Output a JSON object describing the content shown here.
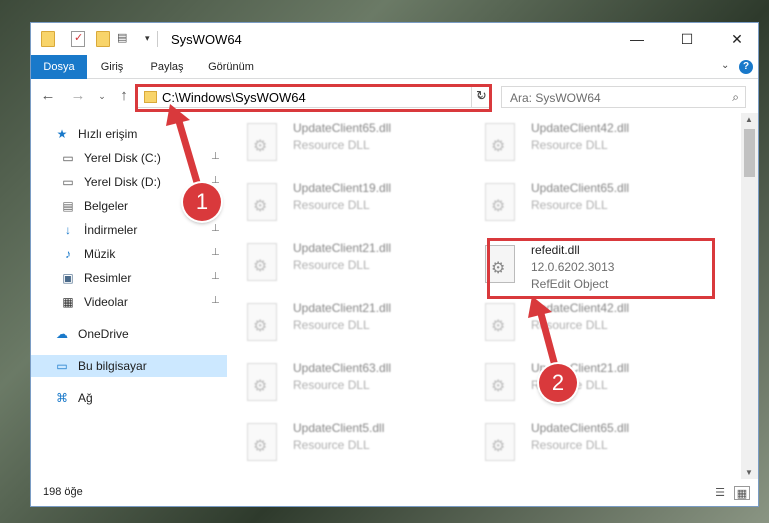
{
  "window": {
    "title": "SysWOW64",
    "minimize": "—",
    "maximize": "☐",
    "close": "✕"
  },
  "ribbon": {
    "tabs": [
      "Dosya",
      "Giriş",
      "Paylaş",
      "Görünüm"
    ],
    "help": "?",
    "expand": "⌄"
  },
  "nav": {
    "back": "←",
    "forward": "→",
    "recent": "⌄",
    "up": "↑",
    "address": "C:\\Windows\\SysWOW64",
    "address_chevron": "⌄",
    "refresh": "↻",
    "search_placeholder": "Ara: SysWOW64",
    "search_icon": "⌕"
  },
  "sidebar": {
    "items": [
      {
        "label": "Hızlı erişim",
        "icon": "★",
        "pinned": false,
        "top": true
      },
      {
        "label": "Yerel Disk (C:)",
        "icon": "▭",
        "pinned": true
      },
      {
        "label": "Yerel Disk (D:)",
        "icon": "▭",
        "pinned": true
      },
      {
        "label": "Belgeler",
        "icon": "▤",
        "pinned": true
      },
      {
        "label": "İndirmeler",
        "icon": "↓",
        "pinned": true
      },
      {
        "label": "Müzik",
        "icon": "♪",
        "pinned": true
      },
      {
        "label": "Resimler",
        "icon": "▣",
        "pinned": true
      },
      {
        "label": "Videolar",
        "icon": "▦",
        "pinned": true
      },
      {
        "label": "OneDrive",
        "icon": "☁",
        "pinned": false,
        "top": true
      },
      {
        "label": "Bu bilgisayar",
        "icon": "▭",
        "pinned": false,
        "top": true,
        "selected": true
      },
      {
        "label": "Ağ",
        "icon": "⌘",
        "pinned": false,
        "top": true
      }
    ],
    "pin_glyph": "📌"
  },
  "files": {
    "left": [
      {
        "name": "UpdateClient65.dll",
        "type": "Resource DLL"
      },
      {
        "name": "UpdateClient19.dll",
        "type": "Resource DLL"
      },
      {
        "name": "UpdateClient21.dll",
        "type": "Resource DLL"
      },
      {
        "name": "UpdateClient21.dll",
        "type": "Resource DLL"
      },
      {
        "name": "UpdateClient63.dll",
        "type": "Resource DLL"
      },
      {
        "name": "UpdateClient5.dll",
        "type": "Resource DLL"
      }
    ],
    "right": [
      {
        "name": "UpdateClient42.dll",
        "type": "Resource DLL"
      },
      {
        "name": "UpdateClient65.dll",
        "type": "Resource DLL"
      },
      {
        "name": "refedit.dll",
        "version": "12.0.6202.3013",
        "type": "RefEdit Object",
        "highlighted": true
      },
      {
        "name": "UpdateClient42.dll",
        "type": "Resource DLL"
      },
      {
        "name": "UpdateClient21.dll",
        "type": "Resource DLL"
      },
      {
        "name": "UpdateClient65.dll",
        "type": "Resource DLL"
      }
    ]
  },
  "status": {
    "item_count": "198 öğe",
    "details_view": "☰",
    "tiles_view": "▦"
  },
  "annotations": {
    "badge1": "1",
    "badge2": "2",
    "color": "#d9393c"
  }
}
